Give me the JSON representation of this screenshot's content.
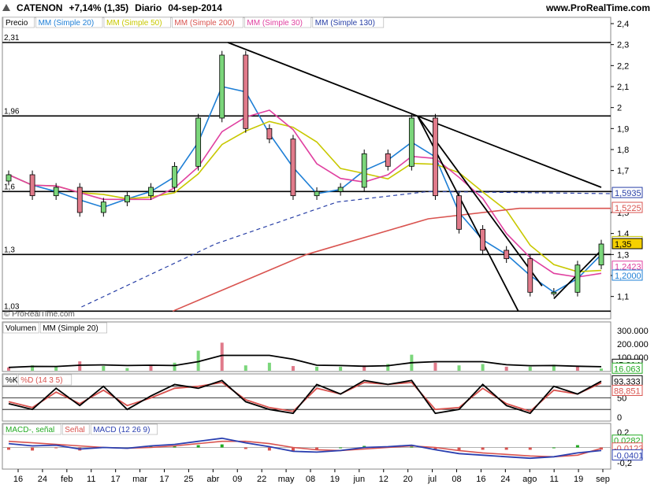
{
  "header": {
    "ticker": "CATENON",
    "change": "+7,14% (1,35)",
    "period": "Diario",
    "date": "04-sep-2014",
    "site": "www.ProRealTime.com",
    "watermark": "© ProRealTime.com"
  },
  "panels": {
    "price": {
      "legend": [
        "Precio",
        "MM (Simple 20)",
        "MM (Simple 50)",
        "MM (Simple 200)",
        "MM (Simple 30)",
        "MM (Simple 130)"
      ],
      "ticks": [
        "2,4",
        "2,3",
        "2,2",
        "2,1",
        "2",
        "1,9",
        "1,8",
        "1,7",
        "1,6",
        "1,5",
        "1,4",
        "1,3",
        "1,2",
        "1,1"
      ],
      "levels": [
        "2,31",
        "1,96",
        "1,6",
        "1,3",
        "1,03"
      ],
      "value_labels": [
        {
          "text": "1,5935",
          "color": "#283fa6"
        },
        {
          "text": "1,5225",
          "color": "#d9534f"
        },
        {
          "text": "1,3598",
          "color": "#c8c800"
        },
        {
          "text": "1,35",
          "color": "#000000"
        },
        {
          "text": "1,2423",
          "color": "#e040a0"
        },
        {
          "text": "1,2000",
          "color": "#1e7fd6"
        }
      ]
    },
    "volume": {
      "legend": [
        "Volumen",
        "MM (Simple 20)"
      ],
      "ticks": [
        "300.000",
        "200.000",
        "100.000"
      ],
      "value_labels": [
        {
          "text": "45.214",
          "color": "#000000"
        },
        {
          "text": "16.063",
          "color": "#22aa22"
        }
      ]
    },
    "stoch": {
      "legend": [
        "%K",
        "%D (14 3 5)"
      ],
      "ticks": [
        "50",
        "0"
      ],
      "value_labels": [
        {
          "text": "93,333",
          "color": "#000000"
        },
        {
          "text": "88,851",
          "color": "#d9534f"
        }
      ]
    },
    "macd": {
      "legend": [
        "MACD-, señal",
        "Señal",
        "MACD (12 26 9)"
      ],
      "ticks": [
        "0,2",
        "0",
        "-0,2"
      ],
      "value_labels": [
        {
          "text": "0,0282",
          "color": "#22aa22"
        },
        {
          "text": "-0,0123",
          "color": "#d9534f"
        },
        {
          "text": "-0,0401",
          "color": "#2a3fb0"
        }
      ]
    }
  },
  "xaxis": {
    "labels": [
      "16",
      "24",
      "feb",
      "11",
      "17",
      "mar",
      "17",
      "25",
      "abr",
      "09",
      "22",
      "may",
      "08",
      "19",
      "jun",
      "12",
      "20",
      "jul",
      "08",
      "16",
      "24",
      "ago",
      "11",
      "19",
      "sep"
    ]
  },
  "chart_data": {
    "type": "candlestick",
    "title": "CATENON +7,14% (1,35) Diario 04-sep-2014",
    "ylim": [
      1.0,
      2.42
    ],
    "levels": [
      2.31,
      1.96,
      1.6,
      1.3,
      1.03
    ],
    "last_close": 1.35,
    "moving_averages": [
      {
        "name": "MM (Simple 20)",
        "last": 1.2,
        "color": "#1e7fd6"
      },
      {
        "name": "MM (Simple 50)",
        "last": 1.3598,
        "color": "#c8c800"
      },
      {
        "name": "MM (Simple 200)",
        "last": 1.5225,
        "color": "#d9534f"
      },
      {
        "name": "MM (Simple 30)",
        "last": 1.2423,
        "color": "#e040a0"
      },
      {
        "name": "MM (Simple 130)",
        "last": 1.5935,
        "color": "#283fa6"
      }
    ],
    "x": [
      "01-16",
      "01-24",
      "02-01",
      "02-11",
      "02-17",
      "03-01",
      "03-17",
      "03-25",
      "04-01",
      "04-09",
      "04-22",
      "05-01",
      "05-08",
      "05-19",
      "06-01",
      "06-12",
      "06-20",
      "07-01",
      "07-08",
      "07-16",
      "07-24",
      "08-01",
      "08-11",
      "08-19",
      "09-01",
      "09-04"
    ],
    "close": [
      1.68,
      1.58,
      1.62,
      1.5,
      1.55,
      1.58,
      1.62,
      1.72,
      1.95,
      2.25,
      1.9,
      1.85,
      1.58,
      1.6,
      1.62,
      1.78,
      1.72,
      1.95,
      1.58,
      1.42,
      1.32,
      1.28,
      1.12,
      1.12,
      1.25,
      1.35
    ],
    "volume": [
      25000,
      40000,
      30000,
      70000,
      35000,
      20000,
      40000,
      60000,
      150000,
      210000,
      40000,
      60000,
      35000,
      30000,
      30000,
      40000,
      50000,
      120000,
      60000,
      40000,
      50000,
      30000,
      30000,
      45000,
      30000,
      16063
    ],
    "stoch_k": [
      35,
      20,
      75,
      30,
      80,
      20,
      55,
      85,
      75,
      95,
      40,
      20,
      10,
      85,
      60,
      95,
      85,
      95,
      10,
      20,
      85,
      30,
      10,
      80,
      60,
      93.333
    ],
    "stoch_d": [
      40,
      25,
      65,
      35,
      70,
      30,
      50,
      75,
      80,
      90,
      45,
      25,
      15,
      75,
      60,
      90,
      85,
      90,
      20,
      25,
      75,
      35,
      15,
      70,
      60,
      88.851
    ],
    "macd": [
      0.05,
      0.02,
      0.03,
      -0.02,
      0.0,
      -0.01,
      0.02,
      0.04,
      0.08,
      0.12,
      0.06,
      0.01,
      -0.05,
      -0.06,
      -0.04,
      0.0,
      0.01,
      0.03,
      -0.03,
      -0.08,
      -0.1,
      -0.12,
      -0.14,
      -0.12,
      -0.07,
      -0.0401
    ],
    "signal": [
      0.08,
      0.06,
      0.04,
      0.02,
      0.0,
      -0.01,
      0.0,
      0.02,
      0.05,
      0.08,
      0.08,
      0.05,
      0.0,
      -0.03,
      -0.04,
      -0.02,
      0.0,
      0.02,
      0.0,
      -0.04,
      -0.07,
      -0.09,
      -0.11,
      -0.12,
      -0.1,
      -0.0123
    ]
  }
}
